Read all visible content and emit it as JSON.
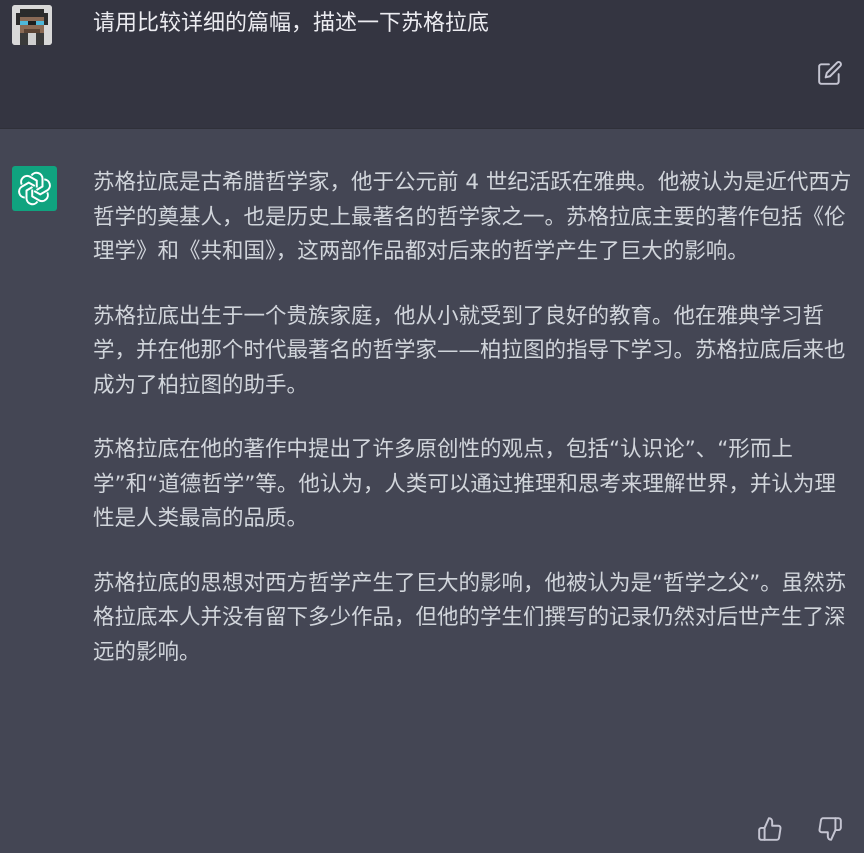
{
  "user": {
    "message": "请用比较详细的篇幅，描述一下苏格拉底"
  },
  "assistant": {
    "paragraphs": [
      "苏格拉底是古希腊哲学家，他于公元前 4 世纪活跃在雅典。他被认为是近代西方哲学的奠基人，也是历史上最著名的哲学家之一。苏格拉底主要的著作包括《伦理学》和《共和国》，这两部作品都对后来的哲学产生了巨大的影响。",
      "苏格拉底出生于一个贵族家庭，他从小就受到了良好的教育。他在雅典学习哲学，并在他那个时代最著名的哲学家——柏拉图的指导下学习。苏格拉底后来也成为了柏拉图的助手。",
      "苏格拉底在他的著作中提出了许多原创性的观点，包括“认识论”、“形而上学”和“道德哲学”等。他认为，人类可以通过推理和思考来理解世界，并认为理性是人类最高的品质。",
      "苏格拉底的思想对西方哲学产生了巨大的影响，他被认为是“哲学之父”。虽然苏格拉底本人并没有留下多少作品，但他的学生们撰写的记录仍然对后世产生了深远的影响。"
    ]
  },
  "icons": {
    "user_avatar": "pixel-avatar-icon",
    "edit": "edit-icon",
    "assistant_avatar": "openai-logo-icon",
    "thumbs_up": "thumbs-up-icon",
    "thumbs_down": "thumbs-down-icon"
  },
  "colors": {
    "user_bg": "#343541",
    "assistant_bg": "#444654",
    "brand_green": "#10a37f",
    "text": "#d1d5db"
  }
}
